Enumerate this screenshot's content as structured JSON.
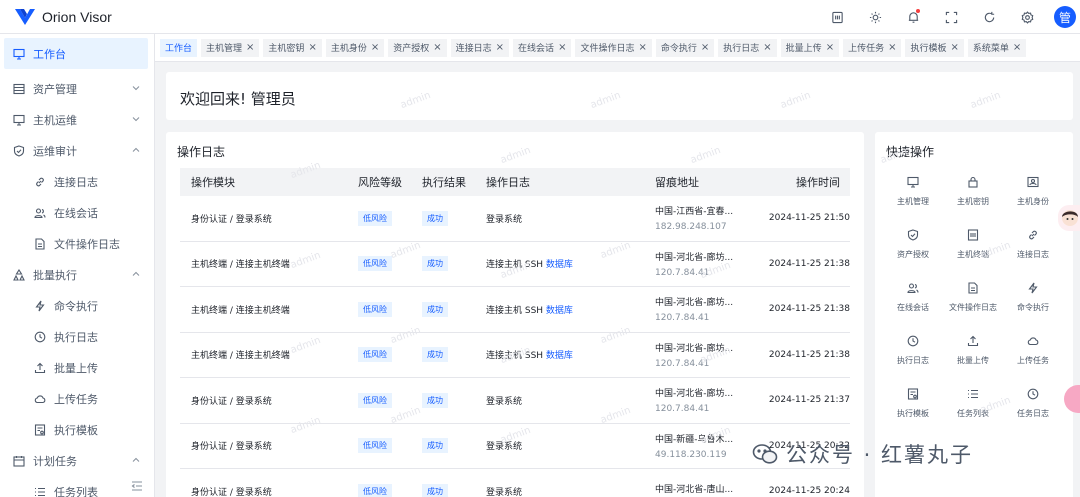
{
  "header": {
    "app_name": "Orion Visor",
    "avatar_text": "管",
    "icons": [
      "doc-icon",
      "theme-icon",
      "bell-icon",
      "fullscreen-icon",
      "refresh-icon",
      "settings-icon"
    ]
  },
  "sidebar": {
    "items": [
      {
        "label": "工作台",
        "icon": "dashboard-icon",
        "active": true
      },
      {
        "label": "资产管理",
        "icon": "asset-icon",
        "expandable": true
      },
      {
        "label": "主机运维",
        "icon": "monitor-icon",
        "expandable": true
      },
      {
        "label": "运维审计",
        "icon": "shield-icon",
        "expanded": true
      },
      {
        "label": "连接日志",
        "icon": "link-icon",
        "sub": true
      },
      {
        "label": "在线会话",
        "icon": "users-icon",
        "sub": true
      },
      {
        "label": "文件操作日志",
        "icon": "file-icon",
        "sub": true
      },
      {
        "label": "批量执行",
        "icon": "cluster-icon",
        "expanded": true
      },
      {
        "label": "命令执行",
        "icon": "bolt-icon",
        "sub": true
      },
      {
        "label": "执行日志",
        "icon": "clock-icon",
        "sub": true
      },
      {
        "label": "批量上传",
        "icon": "upload-icon",
        "sub": true
      },
      {
        "label": "上传任务",
        "icon": "cloud-icon",
        "sub": true
      },
      {
        "label": "执行模板",
        "icon": "template-icon",
        "sub": true
      },
      {
        "label": "计划任务",
        "icon": "calendar-icon",
        "expanded": true
      },
      {
        "label": "任务列表",
        "icon": "list-icon",
        "sub": true
      }
    ]
  },
  "tabs": [
    "工作台",
    "主机管理",
    "主机密钥",
    "主机身份",
    "资产授权",
    "连接日志",
    "在线会话",
    "文件操作日志",
    "命令执行",
    "执行日志",
    "批量上传",
    "上传任务",
    "执行模板",
    "系统菜单"
  ],
  "welcome": {
    "text": "欢迎回来! 管理员"
  },
  "log_panel": {
    "title": "操作日志",
    "columns": [
      "操作模块",
      "风险等级",
      "执行结果",
      "操作日志",
      "留痕地址",
      "操作时间"
    ],
    "rows": [
      {
        "module": "身份认证 / 登录系统",
        "risk": "低风险",
        "result": "成功",
        "log": "登录系统",
        "log_link": "",
        "addr": "中国-江西省-宜春...",
        "ip": "182.98.248.107",
        "time": "2024-11-25 21:50"
      },
      {
        "module": "主机终端 / 连接主机终端",
        "risk": "低风险",
        "result": "成功",
        "log": "连接主机 SSH ",
        "log_link": "数据库",
        "addr": "中国-河北省-廊坊...",
        "ip": "120.7.84.41",
        "time": "2024-11-25 21:38"
      },
      {
        "module": "主机终端 / 连接主机终端",
        "risk": "低风险",
        "result": "成功",
        "log": "连接主机 SSH ",
        "log_link": "数据库",
        "addr": "中国-河北省-廊坊...",
        "ip": "120.7.84.41",
        "time": "2024-11-25 21:38"
      },
      {
        "module": "主机终端 / 连接主机终端",
        "risk": "低风险",
        "result": "成功",
        "log": "连接主机 SSH ",
        "log_link": "数据库",
        "addr": "中国-河北省-廊坊...",
        "ip": "120.7.84.41",
        "time": "2024-11-25 21:38"
      },
      {
        "module": "身份认证 / 登录系统",
        "risk": "低风险",
        "result": "成功",
        "log": "登录系统",
        "log_link": "",
        "addr": "中国-河北省-廊坊...",
        "ip": "120.7.84.41",
        "time": "2024-11-25 21:37"
      },
      {
        "module": "身份认证 / 登录系统",
        "risk": "低风险",
        "result": "成功",
        "log": "登录系统",
        "log_link": "",
        "addr": "中国-新疆-乌鲁木...",
        "ip": "49.118.230.119",
        "time": "2024-11-25 20:32"
      },
      {
        "module": "身份认证 / 登录系统",
        "risk": "低风险",
        "result": "成功",
        "log": "登录系统",
        "log_link": "",
        "addr": "中国-河北省-唐山...",
        "ip": "",
        "time": "2024-11-25 20:24"
      }
    ]
  },
  "quick_panel": {
    "title": "快捷操作",
    "items": [
      {
        "label": "主机管理",
        "icon": "monitor-icon"
      },
      {
        "label": "主机密钥",
        "icon": "lock-icon"
      },
      {
        "label": "主机身份",
        "icon": "id-card-icon"
      },
      {
        "label": "资产授权",
        "icon": "shield-check-icon"
      },
      {
        "label": "主机终端",
        "icon": "terminal-icon"
      },
      {
        "label": "连接日志",
        "icon": "link-icon"
      },
      {
        "label": "在线会话",
        "icon": "users-icon"
      },
      {
        "label": "文件操作日志",
        "icon": "file-icon"
      },
      {
        "label": "命令执行",
        "icon": "bolt-icon"
      },
      {
        "label": "执行日志",
        "icon": "clock-icon"
      },
      {
        "label": "批量上传",
        "icon": "upload-icon"
      },
      {
        "label": "上传任务",
        "icon": "cloud-icon"
      },
      {
        "label": "执行模板",
        "icon": "template-icon"
      },
      {
        "label": "任务列表",
        "icon": "list-icon"
      },
      {
        "label": "任务日志",
        "icon": "clock-icon"
      }
    ]
  },
  "watermark": "admin",
  "overlay": {
    "wechat_text": "公众号 · 红薯丸子"
  },
  "colors": {
    "primary": "#165dff",
    "tag_bg": "#e8f3ff",
    "bg": "#f2f3f5"
  }
}
